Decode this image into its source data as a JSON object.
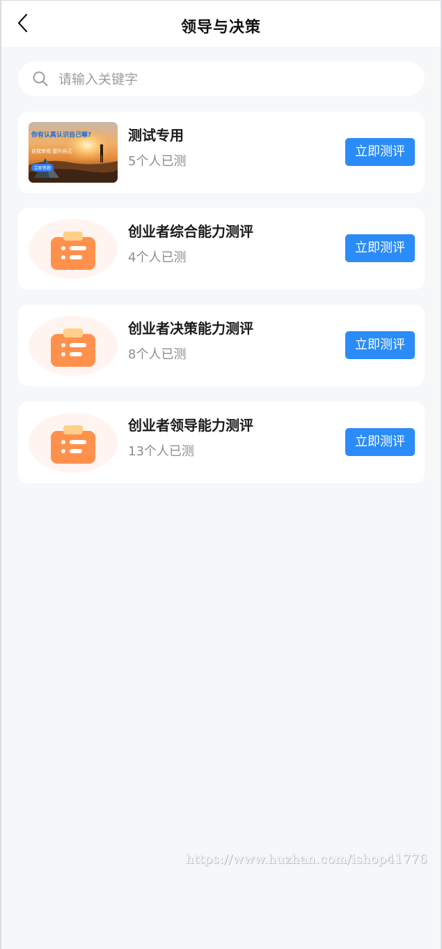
{
  "header": {
    "title": "领导与决策",
    "back_icon": "chevron-left-icon"
  },
  "search": {
    "placeholder": "请输入关键字",
    "value": "",
    "icon": "search-icon"
  },
  "cards": [
    {
      "title": "测试专用",
      "count": "5个人已测",
      "button": "立即测评",
      "thumb": {
        "headline": "你有认真认识自己嘛?",
        "subline": "自我审视  提升自己",
        "button": "立即答题"
      }
    },
    {
      "title": "创业者综合能力测评",
      "count": "4个人已测",
      "button": "立即测评",
      "icon": "clipboard-icon"
    },
    {
      "title": "创业者决策能力测评",
      "count": "8个人已测",
      "button": "立即测评",
      "icon": "clipboard-icon"
    },
    {
      "title": "创业者领导能力测评",
      "count": "13个人已测",
      "button": "立即测评",
      "icon": "clipboard-icon"
    }
  ],
  "watermark": "https://www.huzhan.com/ishop41776",
  "colors": {
    "accent": "#2b8cf7",
    "background": "#f6f7f9",
    "icon_orange": "#ff914d",
    "icon_circle": "#fff4ef"
  }
}
